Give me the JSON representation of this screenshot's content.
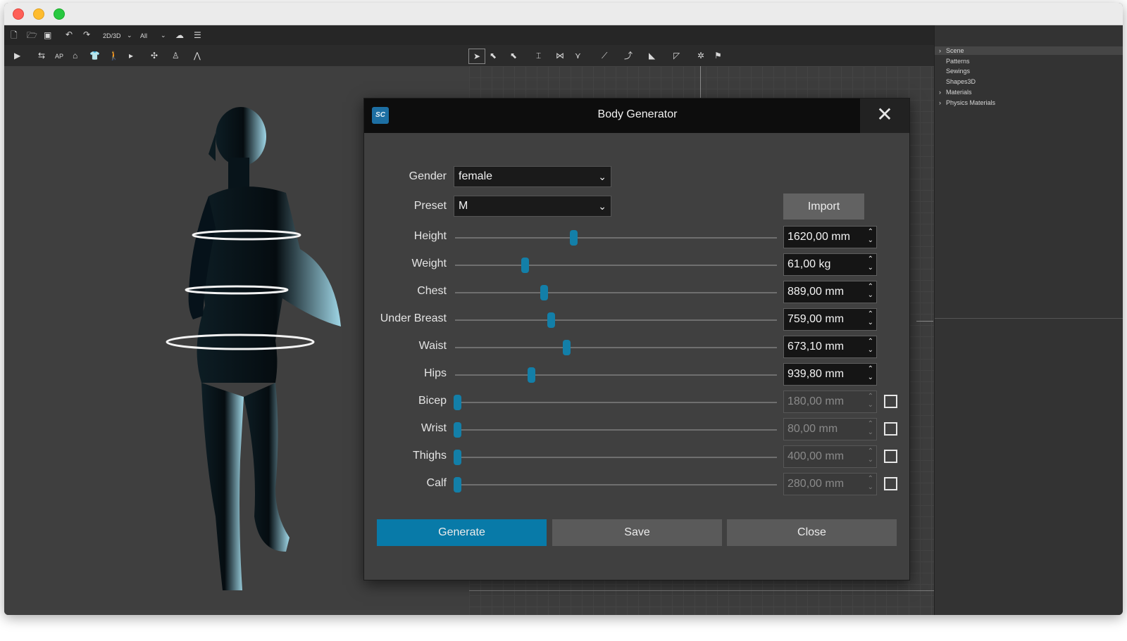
{
  "toolbar": {
    "mode_select": "2D/3D",
    "filter_select": "All",
    "ap_label": "AP"
  },
  "scene_tree": {
    "items": [
      "Scene",
      "Patterns",
      "Sewings",
      "Shapes3D",
      "Materials",
      "Physics Materials"
    ]
  },
  "dialog": {
    "title": "Body Generator",
    "logo_text": "SC",
    "gender_label": "Gender",
    "gender_value": "female",
    "preset_label": "Preset",
    "preset_value": "M",
    "import_label": "Import",
    "params": [
      {
        "label": "Height",
        "value": "1620,00 mm",
        "slider": 0.36,
        "enabled": true
      },
      {
        "label": "Weight",
        "value": "61,00 kg",
        "slider": 0.21,
        "enabled": true
      },
      {
        "label": "Chest",
        "value": "889,00 mm",
        "slider": 0.27,
        "enabled": true
      },
      {
        "label": "Under Breast",
        "value": "759,00 mm",
        "slider": 0.29,
        "enabled": true
      },
      {
        "label": "Waist",
        "value": "673,10 mm",
        "slider": 0.34,
        "enabled": true
      },
      {
        "label": "Hips",
        "value": "939,80 mm",
        "slider": 0.23,
        "enabled": true
      },
      {
        "label": "Bicep",
        "value": "180,00 mm",
        "slider": 0.0,
        "enabled": false
      },
      {
        "label": "Wrist",
        "value": "80,00 mm",
        "slider": 0.0,
        "enabled": false
      },
      {
        "label": "Thighs",
        "value": "400,00 mm",
        "slider": 0.0,
        "enabled": false
      },
      {
        "label": "Calf",
        "value": "280,00 mm",
        "slider": 0.0,
        "enabled": false
      }
    ],
    "buttons": {
      "generate": "Generate",
      "save": "Save",
      "close": "Close"
    }
  },
  "colors": {
    "accent": "#087aa8",
    "slider_handle": "#137fa8"
  }
}
